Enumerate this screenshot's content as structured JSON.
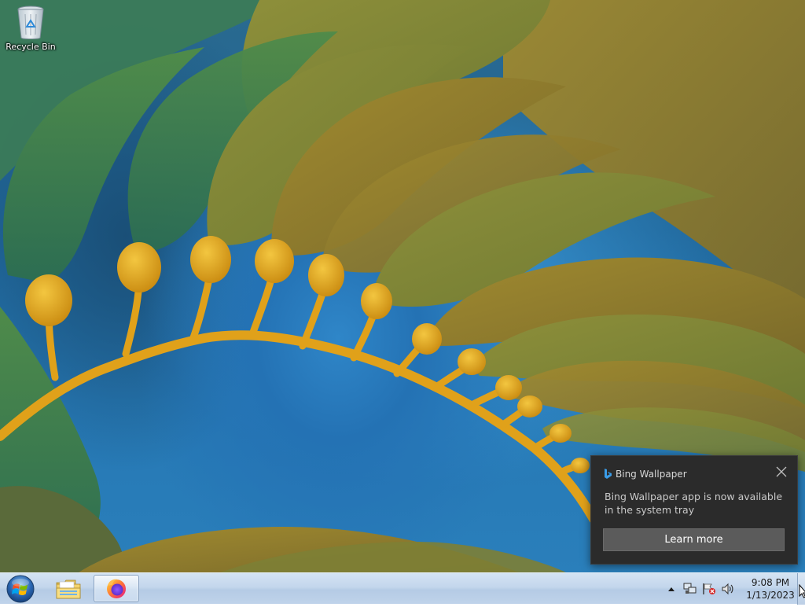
{
  "desktop": {
    "icons": [
      {
        "label": "Recycle Bin",
        "icon": "recycle-bin-icon"
      }
    ]
  },
  "toast": {
    "app_name": "Bing Wallpaper",
    "app_icon": "bing-logo-icon",
    "message": "Bing Wallpaper app is now available in the system tray",
    "button_label": "Learn more",
    "close_icon": "close-icon"
  },
  "taskbar": {
    "start_icon": "windows-start-orb-icon",
    "pinned": [
      {
        "name": "Windows Explorer",
        "icon": "folder-explorer-icon",
        "active": false
      },
      {
        "name": "Firefox",
        "icon": "firefox-icon",
        "active": true
      }
    ],
    "tray": {
      "icons": [
        "show-hidden-icons-arrow-icon",
        "network-icon",
        "action-center-flag-icon",
        "volume-icon"
      ],
      "time": "9:08 PM",
      "date": "1/13/2023"
    }
  },
  "colors": {
    "taskbar_top": "#d4e3f3",
    "toast_bg": "#2b2b2b",
    "toast_button": "#5b5b5b",
    "kelp_gold": "#e0a11a",
    "water_blue": "#2a7fbb"
  }
}
